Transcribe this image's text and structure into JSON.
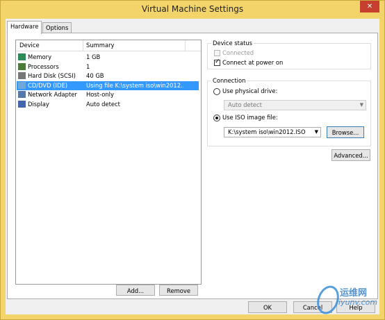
{
  "window": {
    "title": "Virtual Machine Settings",
    "close_glyph": "✕"
  },
  "tabs": [
    {
      "label": "Hardware"
    },
    {
      "label": "Options"
    }
  ],
  "device_list": {
    "columns": [
      "Device",
      "Summary"
    ],
    "rows": [
      {
        "device": "Memory",
        "summary": "1 GB",
        "icon": "memory-icon",
        "color": "#2e8b57"
      },
      {
        "device": "Processors",
        "summary": "1",
        "icon": "processor-icon",
        "color": "#4a7b3a"
      },
      {
        "device": "Hard Disk (SCSI)",
        "summary": "40 GB",
        "icon": "hard-disk-icon",
        "color": "#777777"
      },
      {
        "device": "CD/DVD (IDE)",
        "summary": "Using file K:\\system iso\\win2012....",
        "icon": "cd-dvd-icon",
        "color": "#6fa8dc",
        "selected": true
      },
      {
        "device": "Network Adapter",
        "summary": "Host-only",
        "icon": "network-adapter-icon",
        "color": "#5577aa"
      },
      {
        "device": "Display",
        "summary": "Auto detect",
        "icon": "display-icon",
        "color": "#4466aa"
      }
    ],
    "add_label": "Add...",
    "remove_label": "Remove"
  },
  "device_status": {
    "title": "Device status",
    "connected_label": "Connected",
    "connected": false,
    "connect_at_power_on_label": "Connect at power on",
    "connect_at_power_on": true
  },
  "connection": {
    "title": "Connection",
    "physical_drive_label": "Use physical drive:",
    "physical_drive_value": "Auto detect",
    "iso_label": "Use ISO image file:",
    "iso_value": "K:\\system iso\\win2012.ISO",
    "browse_label": "Browse...",
    "selected_option": "iso"
  },
  "advanced_label": "Advanced...",
  "footer": {
    "ok_label": "OK",
    "cancel_label": "Cancel",
    "help_label": "Help"
  },
  "watermark": {
    "text": "运维网",
    "url": "iyunv.com"
  }
}
